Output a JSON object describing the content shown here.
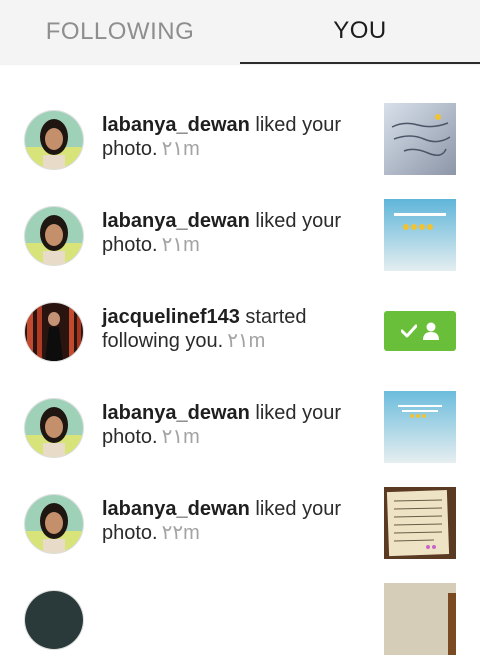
{
  "tabs": {
    "following": "FOLLOWING",
    "you": "YOU"
  },
  "feed": [
    {
      "username": "labanya_dewan",
      "action": "liked your photo.",
      "time": "٢١m",
      "thumb": "caption-photo"
    },
    {
      "username": "labanya_dewan",
      "action": "liked your photo.",
      "time": "٢١m",
      "thumb": "sky-photo"
    },
    {
      "username": "jacquelinef143",
      "action": "started following you.",
      "time": "٢١m",
      "button": "follow-back-icon"
    },
    {
      "username": "labanya_dewan",
      "action": "liked your photo.",
      "time": "٢١m",
      "thumb": "sky-photo"
    },
    {
      "username": "labanya_dewan",
      "action": "liked your photo.",
      "time": "٢٢m",
      "thumb": "letter-photo"
    }
  ],
  "colors": {
    "follow_button": "#6abf3a",
    "time": "#a3a3a3"
  }
}
